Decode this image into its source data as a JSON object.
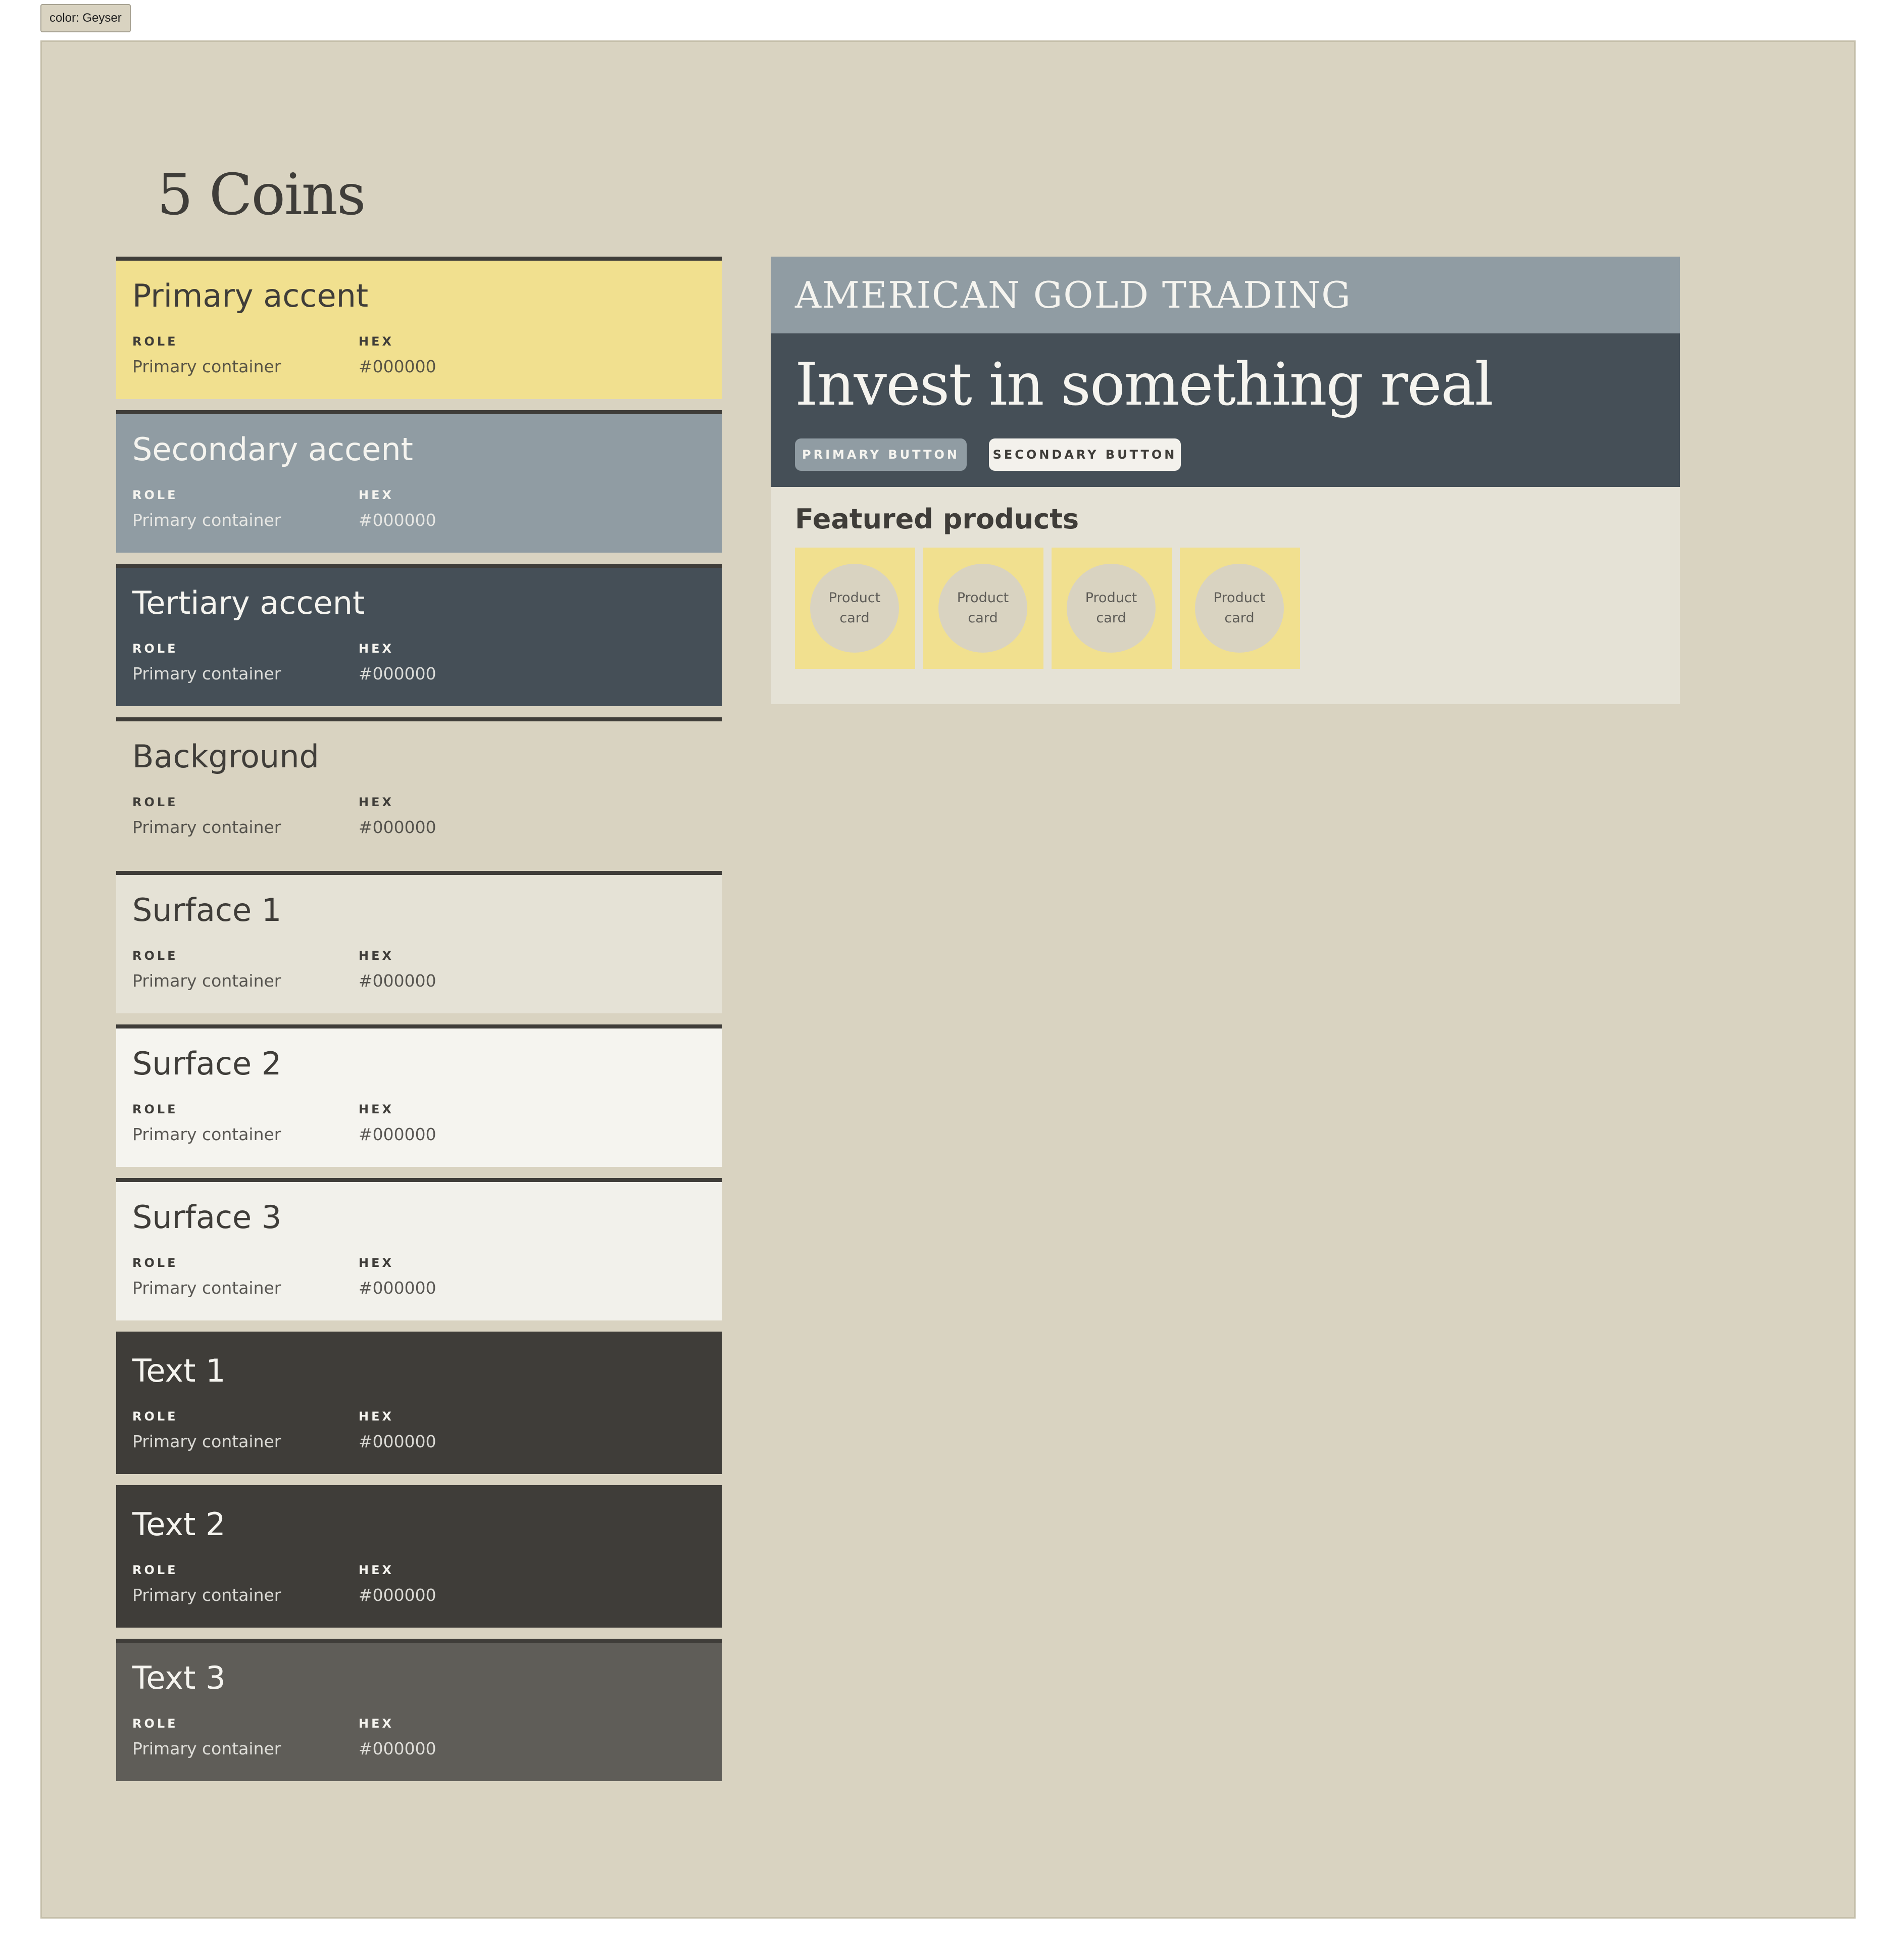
{
  "color_tag": "color: Geyser",
  "page_title": "5 Coins",
  "swatches": [
    {
      "name": "Primary accent",
      "role_label": "ROLE",
      "hex_label": "HEX",
      "role": "Primary container",
      "hex": "#000000",
      "bg": "#f1e08f",
      "fg": "#3f3d39"
    },
    {
      "name": "Secondary accent",
      "role_label": "ROLE",
      "hex_label": "HEX",
      "role": "Primary container",
      "hex": "#000000",
      "bg": "#909ca3",
      "fg": "#f5f4ef"
    },
    {
      "name": "Tertiary accent",
      "role_label": "ROLE",
      "hex_label": "HEX",
      "role": "Primary container",
      "hex": "#000000",
      "bg": "#454f57",
      "fg": "#f5f4ef"
    },
    {
      "name": "Background",
      "role_label": "ROLE",
      "hex_label": "HEX",
      "role": "Primary container",
      "hex": "#000000",
      "bg": "#d9d3c1",
      "fg": "#3f3d39"
    },
    {
      "name": "Surface 1",
      "role_label": "ROLE",
      "hex_label": "HEX",
      "role": "Primary container",
      "hex": "#000000",
      "bg": "#e5e2d6",
      "fg": "#3f3d39"
    },
    {
      "name": "Surface 2",
      "role_label": "ROLE",
      "hex_label": "HEX",
      "role": "Primary container",
      "hex": "#000000",
      "bg": "#f5f4ef",
      "fg": "#3f3d39"
    },
    {
      "name": "Surface 3",
      "role_label": "ROLE",
      "hex_label": "HEX",
      "role": "Primary container",
      "hex": "#000000",
      "bg": "#f2f1eb",
      "fg": "#3f3d39"
    },
    {
      "name": "Text 1",
      "role_label": "ROLE",
      "hex_label": "HEX",
      "role": "Primary container",
      "hex": "#000000",
      "bg": "#3f3d39",
      "fg": "#f5f4ef"
    },
    {
      "name": "Text 2",
      "role_label": "ROLE",
      "hex_label": "HEX",
      "role": "Primary container",
      "hex": "#000000",
      "bg": "#3f3d39",
      "fg": "#f5f4ef"
    },
    {
      "name": "Text 3",
      "role_label": "ROLE",
      "hex_label": "HEX",
      "role": "Primary container",
      "hex": "#000000",
      "bg": "#5f5d58",
      "fg": "#f5f4ef"
    }
  ],
  "preview": {
    "brand": "AMERICAN GOLD TRADING",
    "headline": "Invest in something real",
    "primary_button": "PRIMARY BUTTON",
    "secondary_button": "SECONDARY BUTTON",
    "featured_title": "Featured products",
    "product_cards": [
      "Product card",
      "Product card",
      "Product card",
      "Product card"
    ]
  }
}
